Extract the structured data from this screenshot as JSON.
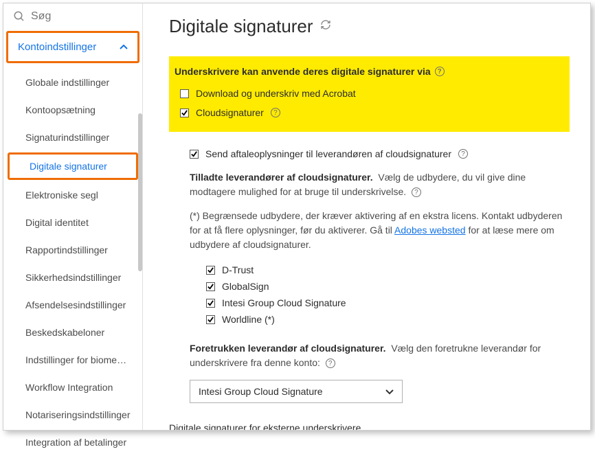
{
  "search": {
    "placeholder": "Søg"
  },
  "sidebar": {
    "section_label": "Kontoindstillinger",
    "items": [
      {
        "label": "Globale indstillinger"
      },
      {
        "label": "Kontoopsætning"
      },
      {
        "label": "Signaturindstillinger"
      },
      {
        "label": "Digitale signaturer",
        "active": true
      },
      {
        "label": "Elektroniske segl"
      },
      {
        "label": "Digital identitet"
      },
      {
        "label": "Rapportindstillinger"
      },
      {
        "label": "Sikkerhedsindstillinger"
      },
      {
        "label": "Afsendelsesindstillinger"
      },
      {
        "label": "Beskedskabeloner"
      },
      {
        "label": "Indstillinger for biomedi…"
      },
      {
        "label": "Workflow Integration"
      },
      {
        "label": "Notariseringsindstillinger"
      },
      {
        "label": "Integration af betalinger"
      }
    ]
  },
  "page": {
    "title": "Digitale signaturer",
    "highlight": {
      "heading": "Underskrivere kan anvende deres digitale signaturer via",
      "options": [
        {
          "label": "Download og underskriv med Acrobat",
          "checked": false
        },
        {
          "label": "Cloudsignaturer",
          "checked": true,
          "info": true
        }
      ]
    },
    "send_info_label": "Send aftaleoplysninger til leverandøren af cloudsignaturer",
    "allowed_heading": "Tilladte leverandører af cloudsignaturer.",
    "allowed_text": "Vælg de udbydere, du vil give dine modtagere mulighed for at bruge til underskrivelse.",
    "restricted_text_1": "(*) Begrænsede udbydere, der kræver aktivering af en ekstra licens. Kontakt udbyderen for at få flere oplysninger, før du aktiverer. Gå til ",
    "restricted_link": "Adobes websted",
    "restricted_text_2": " for at læse mere om udbydere af cloudsignaturer.",
    "providers": [
      {
        "label": "D-Trust",
        "checked": true
      },
      {
        "label": "GlobalSign",
        "checked": true
      },
      {
        "label": "Intesi Group Cloud Signature",
        "checked": true
      },
      {
        "label": "Worldline (*)",
        "checked": true
      }
    ],
    "preferred_heading": "Foretrukken leverandør af cloudsignaturer.",
    "preferred_text": "Vælg den foretrukne leverandør for underskrivere fra denne konto:",
    "preferred_selected": "Intesi Group Cloud Signature",
    "external_heading": "Digitale signaturer for eksterne underskrivere"
  }
}
